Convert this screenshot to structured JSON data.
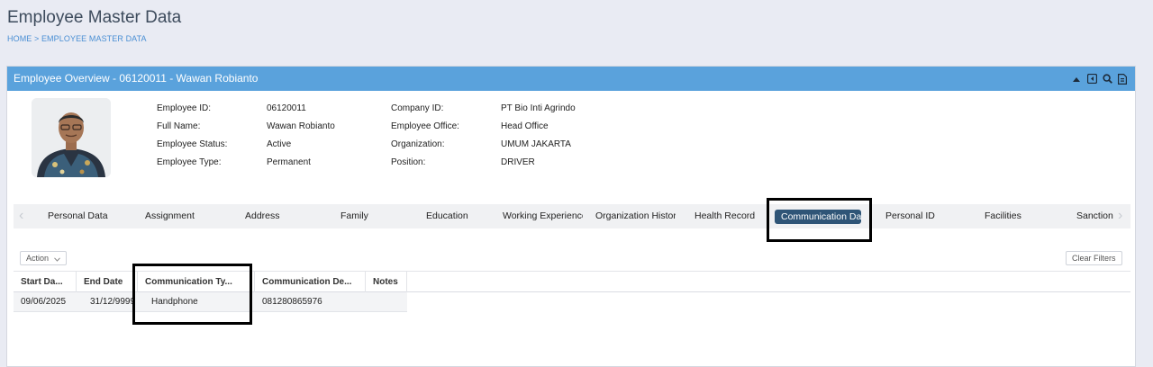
{
  "page": {
    "title": "Employee Master Data",
    "breadcrumb": "HOME > EMPLOYEE MASTER DATA"
  },
  "panel": {
    "title": "Employee Overview - 06120011 - Wawan Robianto",
    "tools": [
      "caret-up-icon",
      "restore-icon",
      "search-icon",
      "document-icon"
    ]
  },
  "employee": {
    "fields_left": [
      {
        "label": "Employee ID:",
        "value": "06120011"
      },
      {
        "label": "Full Name:",
        "value": "Wawan Robianto"
      },
      {
        "label": "Employee Status:",
        "value": "Active"
      },
      {
        "label": "Employee Type:",
        "value": "Permanent"
      }
    ],
    "fields_right": [
      {
        "label": "Company ID:",
        "value": "PT Bio Inti Agrindo"
      },
      {
        "label": "Employee Office:",
        "value": "Head Office"
      },
      {
        "label": "Organization:",
        "value": "UMUM JAKARTA"
      },
      {
        "label": "Position:",
        "value": "DRIVER"
      }
    ]
  },
  "tabs": [
    {
      "label": "Personal Data",
      "active": false
    },
    {
      "label": "Assignment",
      "active": false
    },
    {
      "label": "Address",
      "active": false
    },
    {
      "label": "Family",
      "active": false
    },
    {
      "label": "Education",
      "active": false
    },
    {
      "label": "Working Experience",
      "active": false
    },
    {
      "label": "Organization History",
      "active": false
    },
    {
      "label": "Health Record",
      "active": false
    },
    {
      "label": "Communication Data",
      "active": true
    },
    {
      "label": "Personal ID",
      "active": false
    },
    {
      "label": "Facilities",
      "active": false
    },
    {
      "label": "Sanction",
      "active": false
    }
  ],
  "toolbar": {
    "action_label": "Action",
    "clear_filters_label": "Clear Filters"
  },
  "grid": {
    "columns": [
      "Start Da...",
      "End Date",
      "Communication Ty...",
      "Communication De...",
      "Notes"
    ],
    "rows": [
      [
        "09/06/2025",
        "31/12/9999",
        "Handphone",
        "081280865976",
        ""
      ]
    ]
  },
  "colors": {
    "panel_header": "#5aa2dc",
    "active_tab": "#2f5577",
    "breadcrumb": "#4a8fd4",
    "background": "#e9ebf3"
  }
}
